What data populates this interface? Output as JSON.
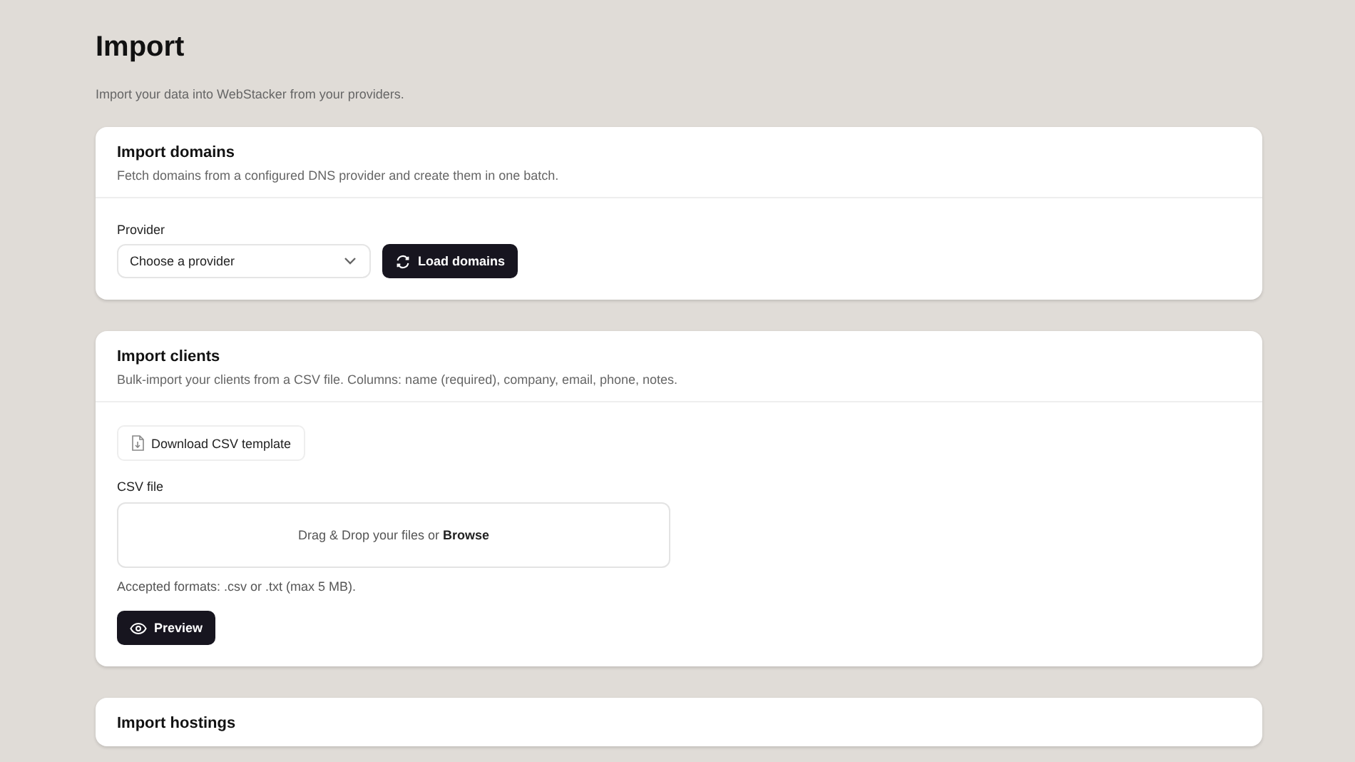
{
  "page": {
    "title": "Import",
    "subtitle": "Import your data into WebStacker from your providers."
  },
  "sections": [
    {
      "kind": "provider",
      "title": "Import domains",
      "description": "Fetch domains from a configured DNS provider and create them in one batch.",
      "field_label": "Provider",
      "select": {
        "placeholder": "Choose a provider"
      },
      "button": "Load domains"
    },
    {
      "kind": "csv",
      "title": "Import clients",
      "description": "Bulk-import your clients from a CSV file. Columns: name (required), company, email, phone, notes.",
      "template_button": "Download CSV template",
      "field_label": "CSV file",
      "dropzone": "Drag & Drop your files or **Browse**",
      "hint": "Accepted formats: .csv or .txt (max 5 MB).",
      "button": "Preview"
    },
    {
      "kind": "cut",
      "title": "Import hostings"
    }
  ]
}
